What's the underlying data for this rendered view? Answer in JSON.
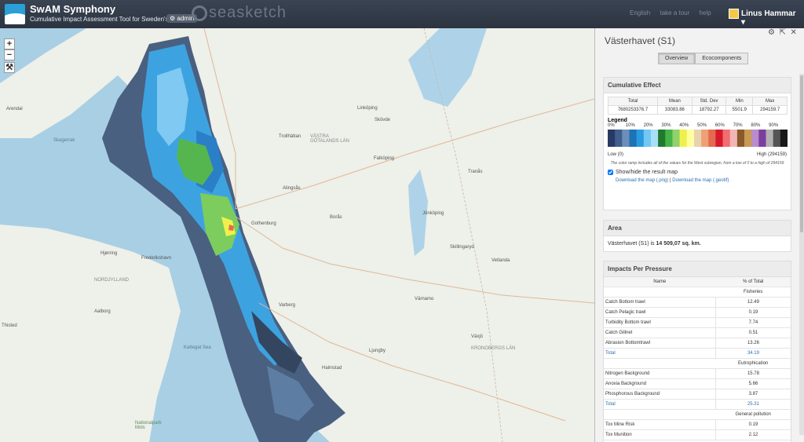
{
  "header": {
    "app_title": "SwAM Symphony",
    "app_subtitle": "Cumulative Impact Assessment Tool for Sweden's MSP",
    "admin_badge": "admin",
    "brand": "seasketch",
    "links": [
      "English",
      "take a tour",
      "help"
    ],
    "user_name": "Linus Hammar"
  },
  "map": {
    "controls": [
      "+",
      "−",
      "wrench-icon"
    ],
    "labels": [
      {
        "text": "Arendal"
      },
      {
        "text": "Skagerrak"
      },
      {
        "text": "Hjørring"
      },
      {
        "text": "Frederikshavn"
      },
      {
        "text": "NORDJYLLAND"
      },
      {
        "text": "Aalborg"
      },
      {
        "text": "Thisted"
      },
      {
        "text": "Kattegat Sea"
      },
      {
        "text": "Linköping"
      },
      {
        "text": "Skövde"
      },
      {
        "text": "Trollhättan"
      },
      {
        "text": "VÄSTRA GÖTALANDS LÄN"
      },
      {
        "text": "Falköping"
      },
      {
        "text": "Alingsås"
      },
      {
        "text": "Gothenburg"
      },
      {
        "text": "Borås"
      },
      {
        "text": "Jönköping"
      },
      {
        "text": "Värnamo"
      },
      {
        "text": "Varberg"
      },
      {
        "text": "Halmstad"
      },
      {
        "text": "Växjö"
      },
      {
        "text": "KRONOBERGS LÄN"
      },
      {
        "text": "Vetlanda"
      },
      {
        "text": "Tranås"
      },
      {
        "text": "Skillingaryd"
      },
      {
        "text": "Ljungby"
      },
      {
        "text": "Nationalpark Mols"
      }
    ]
  },
  "panel": {
    "title": "Västerhavet (S1)",
    "tabs": [
      {
        "label": "Overview",
        "active": true
      },
      {
        "label": "Ecocomponents",
        "active": false
      }
    ],
    "cumulative": {
      "heading": "Cumulative Effect",
      "columns": [
        "Total",
        "Mean",
        "Std. Dev",
        "Min",
        "Max"
      ],
      "values": [
        "7680253376.7",
        "33083.86",
        "18792.27",
        "5501.9",
        "294159.7"
      ],
      "legend_title": "Legend",
      "legend_pcts": [
        "0%",
        "10%",
        "20%",
        "30%",
        "40%",
        "50%",
        "60%",
        "70%",
        "80%",
        "90%"
      ],
      "low_label": "Low (0)",
      "high_label": "High (294159)",
      "note": "The color ramp includes all of the values for the West subregion, from a low of 0 to a high of 294159",
      "checkbox_label": "Show/hide the result map",
      "download_png": "Download the map (.png)",
      "download_sep": "|",
      "download_geotif": "Download the map (.geotif)",
      "ramp_colors": [
        "#283a63",
        "#3f5f8e",
        "#6c8fb8",
        "#1e73b6",
        "#2a9be0",
        "#73c7f2",
        "#a8def7",
        "#1f7a2e",
        "#46b347",
        "#8fd36a",
        "#f0f04d",
        "#ffff9e",
        "#e8d2b0",
        "#f0a074",
        "#e26b4e",
        "#d7192b",
        "#f26d6d",
        "#f2b6b6",
        "#8b5a2b",
        "#c99a54",
        "#b98ccc",
        "#7b3fa0",
        "#b2b2b2",
        "#555555",
        "#1a1a1a"
      ]
    },
    "area": {
      "heading": "Area",
      "text_prefix": "Västerhavet (S1) is ",
      "value": "14 509,07 sq. km."
    },
    "impacts": {
      "heading": "Impacts Per Pressure",
      "columns": [
        "Name",
        "% of Total"
      ],
      "groups": [
        {
          "category": "Fisheries",
          "rows": [
            {
              "name": "Catch Bottom trawl",
              "value": "12.49"
            },
            {
              "name": "Catch Pelagic trawl",
              "value": "0.19"
            },
            {
              "name": "Turbidity Bottom trawl",
              "value": "7.74"
            },
            {
              "name": "Catch Gillnet",
              "value": "0.51"
            },
            {
              "name": "Abrasion Bottomtrawl",
              "value": "13.26"
            }
          ],
          "total_label": "Total",
          "total": "34.19"
        },
        {
          "category": "Eutrophication",
          "rows": [
            {
              "name": "Nitrogen Background",
              "value": "15.78"
            },
            {
              "name": "Anoxia Background",
              "value": "5.66"
            },
            {
              "name": "Phosphorous Background",
              "value": "3.87"
            }
          ],
          "total_label": "Total",
          "total": "25.31"
        },
        {
          "category": "General pollution",
          "rows": [
            {
              "name": "Tox Mine Risk",
              "value": "0.19"
            },
            {
              "name": "Tox Munition",
              "value": "2.12"
            }
          ]
        }
      ]
    }
  }
}
